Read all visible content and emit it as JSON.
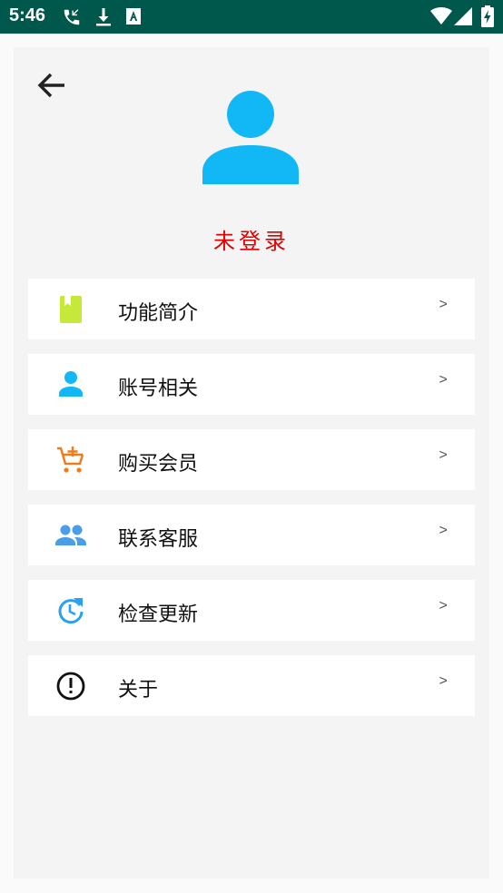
{
  "status_bar": {
    "time": "5:46",
    "icons": [
      "call-received-icon",
      "download-icon",
      "text-a-icon",
      "wifi-icon",
      "signal-icon",
      "battery-charging-icon"
    ]
  },
  "header": {
    "back_icon": "arrow-left-icon",
    "avatar_icon": "person-icon",
    "avatar_color": "#12b7f5",
    "login_status": "未登录",
    "login_status_color": "#e00000"
  },
  "menu": {
    "chevron": ">",
    "items": [
      {
        "label": "功能简介",
        "icon": "book-icon",
        "icon_color": "#c6e83a"
      },
      {
        "label": "账号相关",
        "icon": "person-icon",
        "icon_color": "#12b7f5"
      },
      {
        "label": "购买会员",
        "icon": "cart-add-icon",
        "icon_color": "#ef7b1a"
      },
      {
        "label": "联系客服",
        "icon": "people-icon",
        "icon_color": "#4a9ee8"
      },
      {
        "label": "检查更新",
        "icon": "update-clock-icon",
        "icon_color": "#2aa0f0"
      },
      {
        "label": "关于",
        "icon": "info-circle-icon",
        "icon_color": "#111111"
      }
    ]
  }
}
